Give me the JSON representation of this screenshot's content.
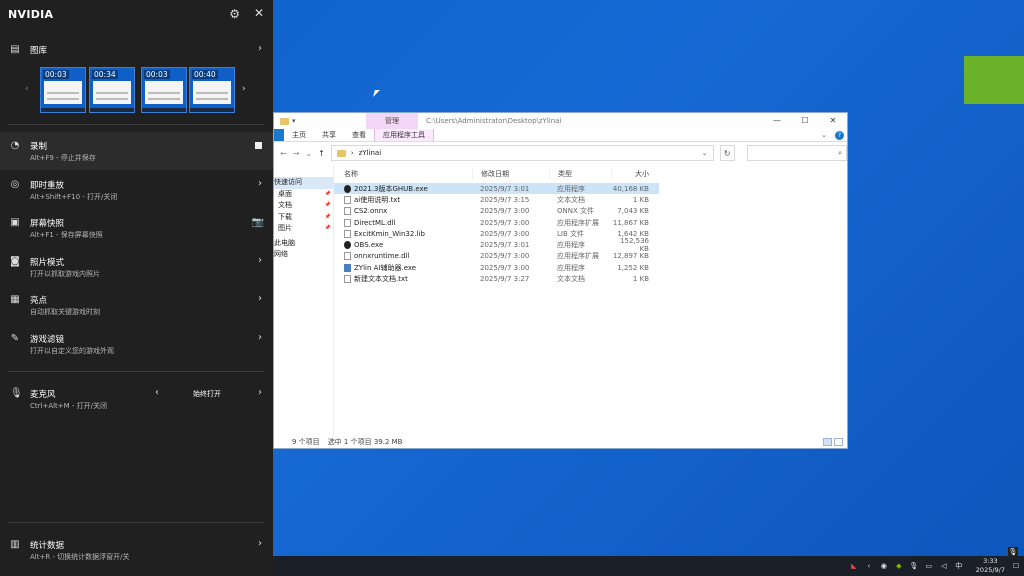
{
  "nvidia": {
    "brand": "NVIDIA",
    "gallery": {
      "label": "图库",
      "thumbs": [
        {
          "duration": "00:03"
        },
        {
          "duration": "00:34"
        },
        {
          "duration": "00:03"
        },
        {
          "duration": "00:40"
        }
      ]
    },
    "items": {
      "record": {
        "title": "录制",
        "sub": "Alt+F9 - 停止并保存"
      },
      "instant_replay": {
        "title": "即时重放",
        "sub": "Alt+Shift+F10 - 打开/关闭"
      },
      "screenshot": {
        "title": "屏幕快照",
        "sub": "Alt+F1 - 保存屏幕快照"
      },
      "photo_mode": {
        "title": "照片模式",
        "sub": "打开以抓取游戏内照片"
      },
      "highlights": {
        "title": "亮点",
        "sub": "自动抓取关键游戏时刻"
      },
      "game_filter": {
        "title": "游戏滤镜",
        "sub": "打开以自定义您的游戏外观"
      },
      "microphone": {
        "title": "麦克风",
        "sub": "Ctrl+Alt+M - 打开/关闭",
        "value": "始终打开"
      },
      "stats": {
        "title": "统计数据",
        "sub": "Alt+R - 切换统计数据浮窗开/关"
      }
    },
    "accent": "#76b900"
  },
  "explorer": {
    "manage_tab": "管理",
    "title_path": "C:\\Users\\Administrator\\Desktop\\zYlinai",
    "ribbon": {
      "home": "主页",
      "share": "共享",
      "view": "查看",
      "app_tools": "应用程序工具"
    },
    "address": "zYlinai",
    "nav": [
      {
        "label": "快速访问",
        "pinned": false
      },
      {
        "label": "桌面",
        "pinned": true
      },
      {
        "label": "文档",
        "pinned": true
      },
      {
        "label": "下载",
        "pinned": true
      },
      {
        "label": "图片",
        "pinned": true
      },
      {
        "label": "此电脑",
        "pinned": false
      },
      {
        "label": "网络",
        "pinned": false
      }
    ],
    "columns": {
      "name": "名称",
      "date": "修改日期",
      "type": "类型",
      "size": "大小"
    },
    "files": [
      {
        "name": "2021.3版本GHUB.exe",
        "date": "2025/9/7 3:01",
        "type": "应用程序",
        "size": "40,168 KB",
        "icon": "exe"
      },
      {
        "name": "ai使用说明.txt",
        "date": "2025/9/7 3:15",
        "type": "文本文档",
        "size": "1 KB",
        "icon": "doc"
      },
      {
        "name": "CS2.onnx",
        "date": "2025/9/7 3:00",
        "type": "ONNX 文件",
        "size": "7,043 KB",
        "icon": "doc"
      },
      {
        "name": "DirectML.dll",
        "date": "2025/9/7 3:00",
        "type": "应用程序扩展",
        "size": "11,867 KB",
        "icon": "doc"
      },
      {
        "name": "ExcitKmin_Win32.lib",
        "date": "2025/9/7 3:00",
        "type": "LIB 文件",
        "size": "1,642 KB",
        "icon": "doc"
      },
      {
        "name": "OBS.exe",
        "date": "2025/9/7 3:01",
        "type": "应用程序",
        "size": "152,536 KB",
        "icon": "exe"
      },
      {
        "name": "onnxruntime.dll",
        "date": "2025/9/7 3:00",
        "type": "应用程序扩展",
        "size": "12,897 KB",
        "icon": "doc"
      },
      {
        "name": "ZYlin AI辅助器.exe",
        "date": "2025/9/7 3:00",
        "type": "应用程序",
        "size": "1,252 KB",
        "icon": "app"
      },
      {
        "name": "新建文本文档.txt",
        "date": "2025/9/7 3:27",
        "type": "文本文档",
        "size": "1 KB",
        "icon": "doc"
      }
    ],
    "status": {
      "items": "9 个项目",
      "selection": "选中 1 个项目  39.2 MB"
    }
  },
  "taskbar": {
    "time": "3:33",
    "date": "2025/9/7"
  }
}
